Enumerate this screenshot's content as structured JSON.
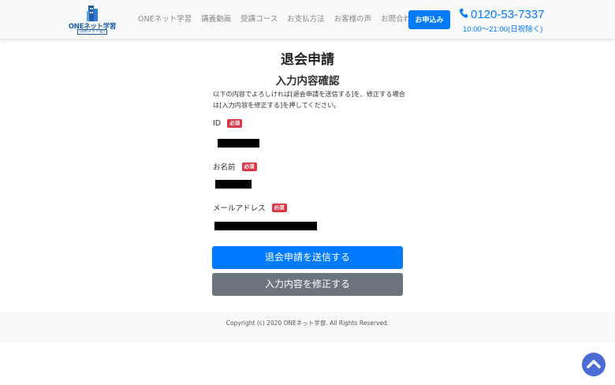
{
  "header": {
    "logo": {
      "name": "ONEネット学習",
      "sub": "(e点ネット塾)"
    },
    "nav": [
      "ONEネット学習",
      "講義動画",
      "受講コース",
      "お支払方法",
      "お客様の声",
      "お問合わせ"
    ],
    "apply_label": "お申込み",
    "phone": "0120-53-7337",
    "hours": "10:00～21:00(日祝除く)"
  },
  "main": {
    "title": "退会申請",
    "section_title": "入力内容確認",
    "instruction": "以下の内容でよろしければ[退会申請を送信する]を、修正する場合は[入力内容を修正する]を押してください。",
    "required_label": "必須",
    "fields": [
      {
        "label": "ID"
      },
      {
        "label": "お名前"
      },
      {
        "label": "メールアドレス"
      }
    ],
    "submit_label": "退会申請を送信する",
    "edit_label": "入力内容を修正する"
  },
  "footer": {
    "copyright": "Copyright (c) 2020 ONEネット学習. All Rights Reserved."
  },
  "colors": {
    "primary": "#007bff",
    "secondary": "#6c757d",
    "badge": "#dc3545",
    "to_top": "#4a6cd4"
  },
  "icons": {
    "phone": "phone-icon",
    "to_top": "chevron-up-icon"
  }
}
